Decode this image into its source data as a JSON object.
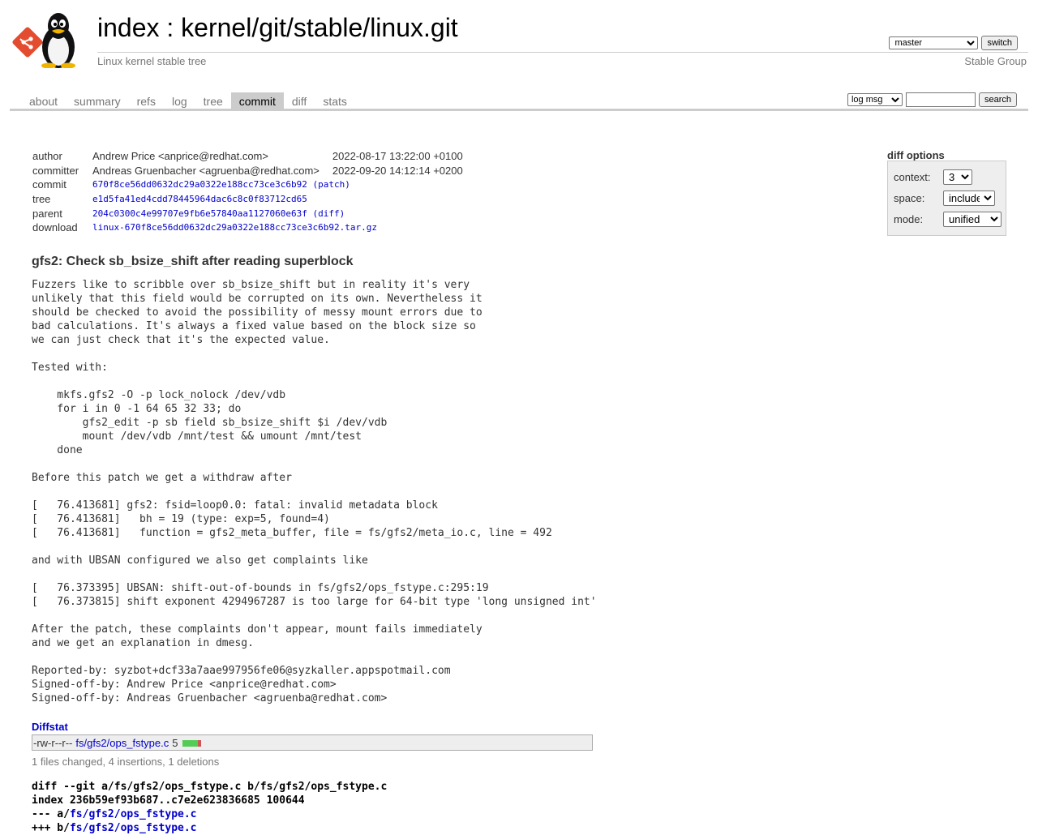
{
  "header": {
    "index_link": "index",
    "separator": " : ",
    "repo_path": "kernel/git/stable/linux.git",
    "description": "Linux kernel stable tree",
    "owner": "Stable Group",
    "branch_selected": "master",
    "switch_label": "switch"
  },
  "tabs": [
    "about",
    "summary",
    "refs",
    "log",
    "tree",
    "commit",
    "diff",
    "stats"
  ],
  "active_tab": "commit",
  "search": {
    "range_selected": "log msg",
    "query": "",
    "button_label": "search"
  },
  "commit": {
    "author_label": "author",
    "author": "Andrew Price <anprice@redhat.com>",
    "author_date": "2022-08-17 13:22:00 +0100",
    "committer_label": "committer",
    "committer": "Andreas Gruenbacher <agruenba@redhat.com>",
    "committer_date": "2022-09-20 14:12:14 +0200",
    "commit_label": "commit",
    "commit_sha": "670f8ce56dd0632dc29a0322e188cc73ce3c6b92",
    "patch_link": "(patch)",
    "tree_label": "tree",
    "tree_sha": "e1d5fa41ed4cdd78445964dac6c8c0f83712cd65",
    "parent_label": "parent",
    "parent_sha": "204c0300c4e99707e9fb6e57840aa1127060e63f",
    "diff_link": "(diff)",
    "download_label": "download",
    "download_file": "linux-670f8ce56dd0632dc29a0322e188cc73ce3c6b92.tar.gz"
  },
  "diff_options": {
    "title": "diff options",
    "context_label": "context:",
    "context_value": "3",
    "space_label": "space:",
    "space_value": "include",
    "mode_label": "mode:",
    "mode_value": "unified"
  },
  "subject": "gfs2: Check sb_bsize_shift after reading superblock",
  "message": "Fuzzers like to scribble over sb_bsize_shift but in reality it's very\nunlikely that this field would be corrupted on its own. Nevertheless it\nshould be checked to avoid the possibility of messy mount errors due to\nbad calculations. It's always a fixed value based on the block size so\nwe can just check that it's the expected value.\n\nTested with:\n\n    mkfs.gfs2 -O -p lock_nolock /dev/vdb\n    for i in 0 -1 64 65 32 33; do\n        gfs2_edit -p sb field sb_bsize_shift $i /dev/vdb\n        mount /dev/vdb /mnt/test && umount /mnt/test\n    done\n\nBefore this patch we get a withdraw after\n\n[   76.413681] gfs2: fsid=loop0.0: fatal: invalid metadata block\n[   76.413681]   bh = 19 (type: exp=5, found=4)\n[   76.413681]   function = gfs2_meta_buffer, file = fs/gfs2/meta_io.c, line = 492\n\nand with UBSAN configured we also get complaints like\n\n[   76.373395] UBSAN: shift-out-of-bounds in fs/gfs2/ops_fstype.c:295:19\n[   76.373815] shift exponent 4294967287 is too large for 64-bit type 'long unsigned int'\n\nAfter the patch, these complaints don't appear, mount fails immediately\nand we get an explanation in dmesg.\n\nReported-by: syzbot+dcf33a7aae997956fe06@syzkaller.appspotmail.com\nSigned-off-by: Andrew Price <anprice@redhat.com>\nSigned-off-by: Andreas Gruenbacher <agruenba@redhat.com>",
  "diffstat": {
    "header": "Diffstat",
    "mode": "-rw-r--r--",
    "file": "fs/gfs2/ops_fstype.c",
    "count": "5",
    "insertions": 4,
    "deletions": 1,
    "summary": "1 files changed, 4 insertions, 1 deletions"
  },
  "diff": {
    "line1": "diff --git a/fs/gfs2/ops_fstype.c b/fs/gfs2/ops_fstype.c",
    "line2": "index 236b59ef93b687..c7e2e623836685 100644",
    "line3_prefix": "--- a/",
    "line3_file": "fs/gfs2/ops_fstype.c",
    "line4_prefix": "+++ b/",
    "line4_file": "fs/gfs2/ops_fstype.c"
  },
  "colors": {
    "link": "#0000cc",
    "active_tab_bg": "#cccccc",
    "added": "#55cc55",
    "deleted": "#cc5555"
  }
}
